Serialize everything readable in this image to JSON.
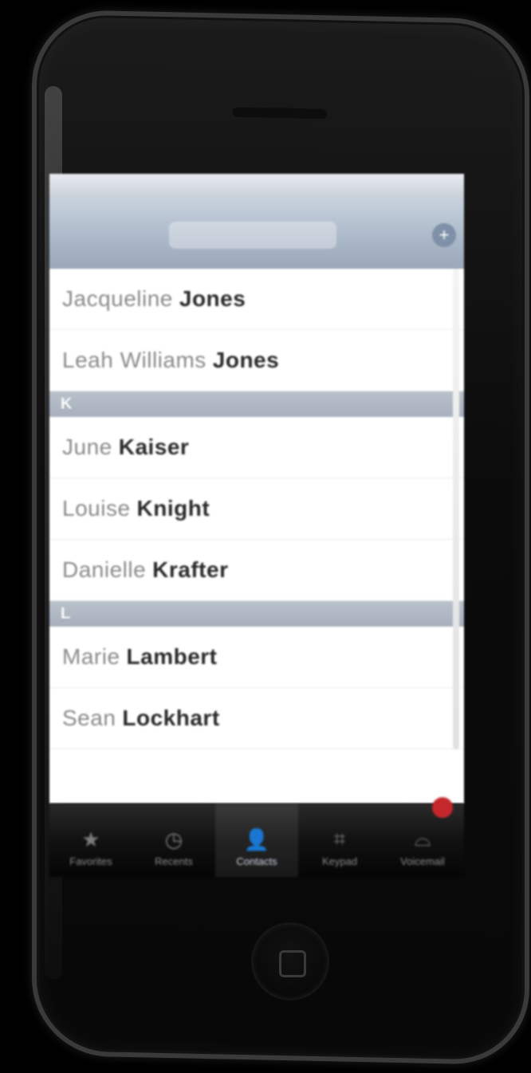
{
  "status_bar": {
    "carrier": "",
    "time": "",
    "battery": ""
  },
  "nav_bar": {
    "title": "",
    "add_icon": "plus-icon"
  },
  "contacts": [
    {
      "section": "",
      "rows": [
        {
          "first": "Jacqueline",
          "last": "Jones"
        },
        {
          "first": "Leah Williams",
          "last": "Jones"
        }
      ]
    },
    {
      "section": "K",
      "rows": [
        {
          "first": "June",
          "last": "Kaiser"
        },
        {
          "first": "Louise",
          "last": "Knight"
        },
        {
          "first": "Danielle",
          "last": "Krafter"
        }
      ]
    },
    {
      "section": "L",
      "rows": [
        {
          "first": "Marie",
          "last": "Lambert"
        },
        {
          "first": "Sean",
          "last": "Lockhart"
        }
      ]
    }
  ],
  "tab_bar": {
    "tabs": [
      {
        "label": "Favorites",
        "icon": "star-icon"
      },
      {
        "label": "Recents",
        "icon": "clock-icon"
      },
      {
        "label": "Contacts",
        "icon": "person-icon",
        "active": true
      },
      {
        "label": "Keypad",
        "icon": "keypad-icon"
      },
      {
        "label": "Voicemail",
        "icon": "voicemail-icon"
      }
    ]
  }
}
